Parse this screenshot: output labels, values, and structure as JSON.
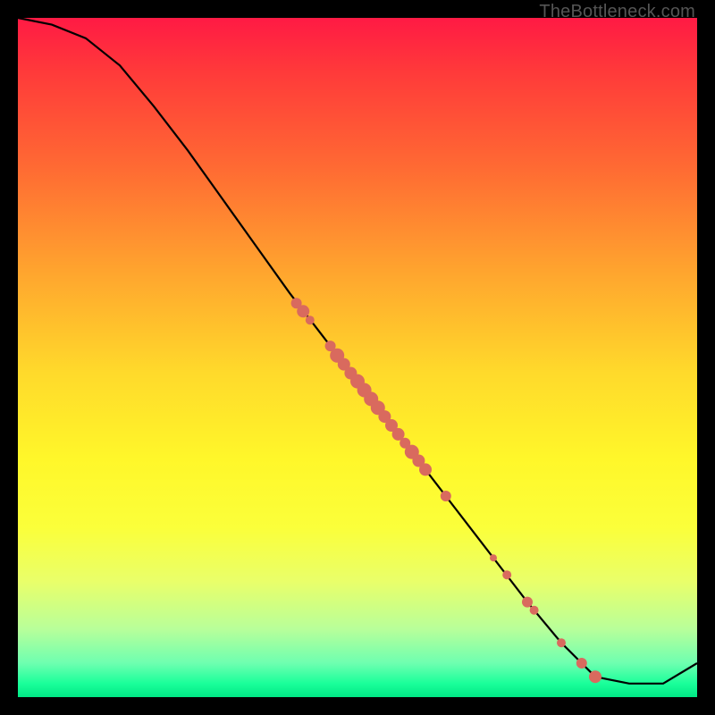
{
  "watermark": "TheBottleneck.com",
  "colors": {
    "dot": "#d96a5e",
    "curve": "#000000",
    "border": "#000000"
  },
  "chart_data": {
    "type": "line",
    "title": "",
    "xlabel": "",
    "ylabel": "",
    "xlim": [
      0,
      100
    ],
    "ylim": [
      0,
      100
    ],
    "grid": false,
    "series": [
      {
        "name": "curve",
        "x": [
          0,
          5,
          10,
          15,
          20,
          25,
          30,
          35,
          40,
          45,
          50,
          55,
          60,
          65,
          70,
          75,
          80,
          85,
          90,
          95,
          100
        ],
        "y": [
          100,
          99,
          97,
          93,
          87,
          80.5,
          73.5,
          66.5,
          59.5,
          53,
          46.5,
          40,
          33.5,
          27,
          20.5,
          14,
          8,
          3,
          2,
          2,
          5
        ]
      }
    ],
    "points": [
      {
        "x": 41,
        "y": 58,
        "r": 6
      },
      {
        "x": 42,
        "y": 56.8,
        "r": 7
      },
      {
        "x": 43,
        "y": 55.5,
        "r": 5
      },
      {
        "x": 46,
        "y": 51.7,
        "r": 6
      },
      {
        "x": 47,
        "y": 50.3,
        "r": 8
      },
      {
        "x": 48,
        "y": 49,
        "r": 7
      },
      {
        "x": 49,
        "y": 47.7,
        "r": 7
      },
      {
        "x": 50,
        "y": 46.5,
        "r": 8
      },
      {
        "x": 51,
        "y": 45.2,
        "r": 8
      },
      {
        "x": 52,
        "y": 43.9,
        "r": 8
      },
      {
        "x": 53,
        "y": 42.6,
        "r": 8
      },
      {
        "x": 54,
        "y": 41.3,
        "r": 7
      },
      {
        "x": 55,
        "y": 40,
        "r": 7
      },
      {
        "x": 56,
        "y": 38.7,
        "r": 7
      },
      {
        "x": 57,
        "y": 37.4,
        "r": 6
      },
      {
        "x": 58,
        "y": 36.1,
        "r": 8
      },
      {
        "x": 59,
        "y": 34.8,
        "r": 7
      },
      {
        "x": 60,
        "y": 33.5,
        "r": 7
      },
      {
        "x": 63,
        "y": 29.6,
        "r": 6
      },
      {
        "x": 70,
        "y": 20.5,
        "r": 4
      },
      {
        "x": 72,
        "y": 18,
        "r": 5
      },
      {
        "x": 75,
        "y": 14,
        "r": 6
      },
      {
        "x": 76,
        "y": 12.8,
        "r": 5
      },
      {
        "x": 80,
        "y": 8,
        "r": 5
      },
      {
        "x": 83,
        "y": 5,
        "r": 6
      },
      {
        "x": 85,
        "y": 3,
        "r": 7
      }
    ]
  }
}
